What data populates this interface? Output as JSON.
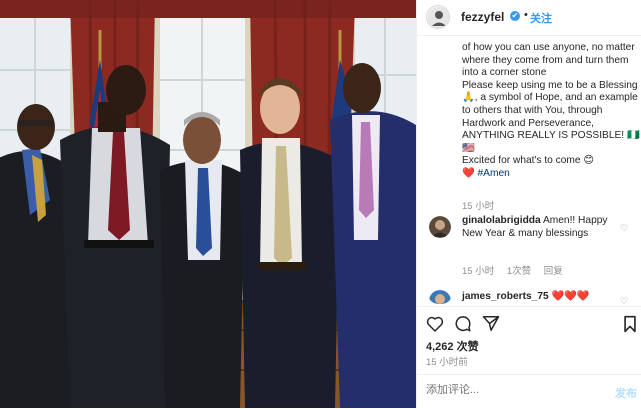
{
  "post": {
    "username": "fezzyfel",
    "verified_mark": "✔",
    "separator": "•",
    "follow_label": "关注",
    "more_label": "•••",
    "caption_text": "of how you can use anyone, no matter where they come from and turn them into a corner stone\nPlease keep using me to be a Blessing 🙏, a symbol of Hope, and an example to others that with You, through Hardwork and Perseverance, ANYTHING REALLY IS POSSIBLE! 🇳🇬 🇺🇸\nExcited for what's to come 😊\n❤️ ",
    "caption_hashtag": "#Amen",
    "caption_time": "15 小时"
  },
  "comments": [
    {
      "username": "ginalolabrigidda",
      "text": " Amen!! Happy New Year & many blessings",
      "time": "15 小时",
      "likes": "1次赞",
      "reply": "回复"
    },
    {
      "username": "james_roberts_75",
      "text": " ❤️❤️❤️"
    }
  ],
  "actions": {
    "like_icon": "heart-outline-icon",
    "comment_icon": "comment-bubble-icon",
    "share_icon": "paper-plane-icon",
    "save_icon": "bookmark-icon"
  },
  "likes_count": "4,262 次赞",
  "post_time": "15 小时前",
  "add_comment": {
    "placeholder": "添加评论...",
    "post_label": "发布"
  },
  "colors": {
    "accent": "#3897f0",
    "text": "#262626",
    "muted": "#8e8e8e",
    "curtain": "#8c2a22",
    "wall": "#e9e2cf"
  }
}
